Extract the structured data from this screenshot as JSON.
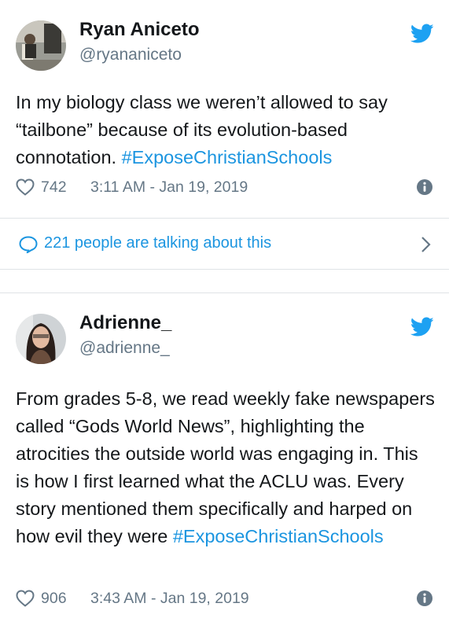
{
  "tweets": [
    {
      "name": "Ryan Aniceto",
      "handle": "@ryananiceto",
      "text_before": "In my biology class we weren’t allowed to say “tailbone” because of its evolution-based connotation. ",
      "hashtag": "#ExposeChristianSchools",
      "text_after": "",
      "likes": "742",
      "timestamp": "3:11 AM - Jan 19, 2019"
    },
    {
      "name": "Adrienne_",
      "handle": "@adrienne_",
      "text_before": "From grades 5-8, we read weekly fake newspapers called “Gods World News”, highlighting the atrocities the outside world was engaging in. This is how I first learned what the ACLU was. Every story mentioned them specifically and harped on how evil they were ",
      "hashtag": "#ExposeChristianSchools",
      "text_after": "",
      "likes": "906",
      "timestamp": "3:43 AM - Jan 19, 2019"
    }
  ],
  "conversation": {
    "label": "221 people are talking about this"
  },
  "icons": {
    "brand": "twitter-bird-icon",
    "like": "heart-icon",
    "info": "info-icon",
    "reply": "speech-bubble-icon",
    "more": "chevron-right-icon"
  },
  "colors": {
    "twitter_blue": "#1da1f2",
    "link_blue": "#1b95e0",
    "text": "#14171a",
    "muted": "#657786",
    "divider": "#dfe3e6"
  }
}
